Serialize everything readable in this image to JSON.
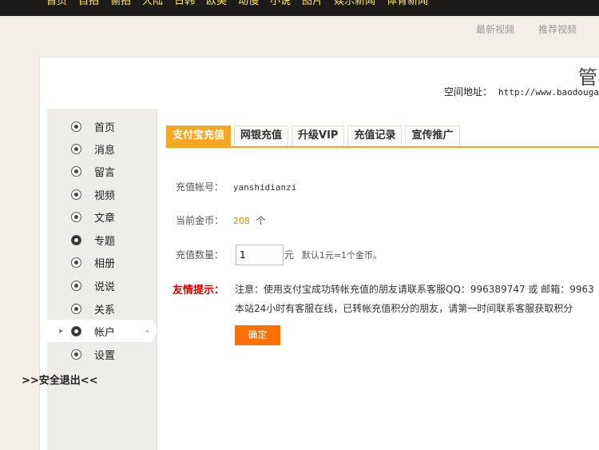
{
  "top_nav": [
    "首页",
    "自拍",
    "偷拍",
    "大陆",
    "日韩",
    "欧美",
    "动慢",
    "小说",
    "图片",
    "娱乐新闻",
    "体育新闻"
  ],
  "sub_nav": {
    "latest_videos": "最新视频",
    "recommended_videos": "推荐视频"
  },
  "header": {
    "title_partial": "管",
    "space_address_label": "空间地址：",
    "space_address_url": "http://www.baodouga"
  },
  "sidebar": {
    "items": [
      {
        "label": "首页",
        "icon": "home-icon"
      },
      {
        "label": "消息",
        "icon": "message-icon"
      },
      {
        "label": "留言",
        "icon": "comment-icon"
      },
      {
        "label": "视频",
        "icon": "video-icon"
      },
      {
        "label": "文章",
        "icon": "article-icon"
      },
      {
        "label": "专题",
        "icon": "topic-icon"
      },
      {
        "label": "相册",
        "icon": "album-icon"
      },
      {
        "label": "说说",
        "icon": "talk-icon"
      },
      {
        "label": "关系",
        "icon": "relation-icon"
      },
      {
        "label": "帐户",
        "icon": "account-icon",
        "active": true
      },
      {
        "label": "设置",
        "icon": "settings-icon"
      }
    ],
    "logout": ">>安全退出<<"
  },
  "tabs": [
    {
      "label": "支付宝充值",
      "active": true
    },
    {
      "label": "网银充值"
    },
    {
      "label": "升级VIP"
    },
    {
      "label": "充值记录"
    },
    {
      "label": "宣传推广"
    }
  ],
  "form": {
    "account_label": "充值帐号：",
    "account_value": "yanshidianzi",
    "coins_label": "当前金币：",
    "coins_value": "208",
    "coins_unit": "个",
    "amount_label": "充值数量：",
    "amount_value": "1",
    "amount_unit": "元",
    "amount_hint": "默认1元=1个金币。",
    "tip_label": "友情提示：",
    "tip_line1": "注意：使用支付宝成功转帐充值的朋友请联系客服QQ：996389747 或 邮箱：9963",
    "tip_line2": "本站24小时有客服在线，已转帐充值积分的朋友，请第一时间联系客服获取积分",
    "confirm_label": "确定"
  },
  "colors": {
    "accent": "#f5a623",
    "button": "#ff7000",
    "tip_red": "#cc0000",
    "nav_text": "#ffe65a"
  }
}
